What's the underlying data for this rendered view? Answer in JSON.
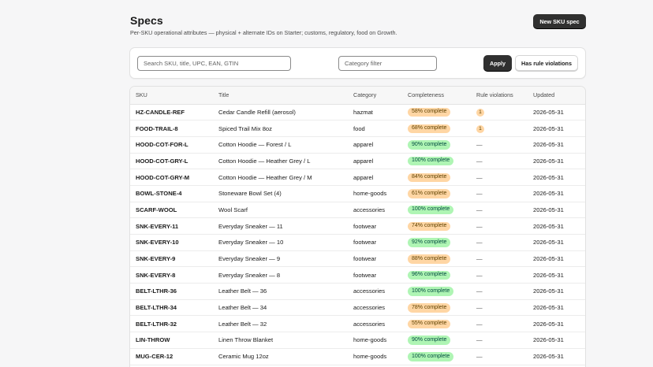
{
  "header": {
    "title": "Specs",
    "subtitle": "Per-SKU operational attributes — physical + alternate IDs on Starter; customs, regulatory, food on Growth.",
    "new_button": "New SKU spec"
  },
  "filters": {
    "search_placeholder": "Search SKU, title, UPC, EAN, GTIN",
    "category_placeholder": "Category filter",
    "apply_label": "Apply",
    "violations_label": "Has rule violations"
  },
  "table": {
    "columns": [
      "SKU",
      "Title",
      "Category",
      "Completeness",
      "Rule violations",
      "Updated"
    ],
    "rows": [
      {
        "sku": "HZ-CANDLE-REF",
        "title": "Cedar Candle Refill (aerosol)",
        "category": "hazmat",
        "completeness": "58% complete",
        "status": "orange",
        "violations": "1",
        "updated": "2026-05-31"
      },
      {
        "sku": "FOOD-TRAIL-8",
        "title": "Spiced Trail Mix 8oz",
        "category": "food",
        "completeness": "68% complete",
        "status": "orange",
        "violations": "1",
        "updated": "2026-05-31"
      },
      {
        "sku": "HOOD-COT-FOR-L",
        "title": "Cotton Hoodie — Forest / L",
        "category": "apparel",
        "completeness": "90% complete",
        "status": "green",
        "violations": "—",
        "updated": "2026-05-31"
      },
      {
        "sku": "HOOD-COT-GRY-L",
        "title": "Cotton Hoodie — Heather Grey / L",
        "category": "apparel",
        "completeness": "100% complete",
        "status": "green",
        "violations": "—",
        "updated": "2026-05-31"
      },
      {
        "sku": "HOOD-COT-GRY-M",
        "title": "Cotton Hoodie — Heather Grey / M",
        "category": "apparel",
        "completeness": "84% complete",
        "status": "orange",
        "violations": "—",
        "updated": "2026-05-31"
      },
      {
        "sku": "BOWL-STONE-4",
        "title": "Stoneware Bowl Set (4)",
        "category": "home-goods",
        "completeness": "61% complete",
        "status": "orange",
        "violations": "—",
        "updated": "2026-05-31"
      },
      {
        "sku": "SCARF-WOOL",
        "title": "Wool Scarf",
        "category": "accessories",
        "completeness": "100% complete",
        "status": "green",
        "violations": "—",
        "updated": "2026-05-31"
      },
      {
        "sku": "SNK-EVERY-11",
        "title": "Everyday Sneaker — 11",
        "category": "footwear",
        "completeness": "74% complete",
        "status": "orange",
        "violations": "—",
        "updated": "2026-05-31"
      },
      {
        "sku": "SNK-EVERY-10",
        "title": "Everyday Sneaker — 10",
        "category": "footwear",
        "completeness": "92% complete",
        "status": "green",
        "violations": "—",
        "updated": "2026-05-31"
      },
      {
        "sku": "SNK-EVERY-9",
        "title": "Everyday Sneaker — 9",
        "category": "footwear",
        "completeness": "88% complete",
        "status": "orange",
        "violations": "—",
        "updated": "2026-05-31"
      },
      {
        "sku": "SNK-EVERY-8",
        "title": "Everyday Sneaker — 8",
        "category": "footwear",
        "completeness": "96% complete",
        "status": "green",
        "violations": "—",
        "updated": "2026-05-31"
      },
      {
        "sku": "BELT-LTHR-36",
        "title": "Leather Belt — 36",
        "category": "accessories",
        "completeness": "100% complete",
        "status": "green",
        "violations": "—",
        "updated": "2026-05-31"
      },
      {
        "sku": "BELT-LTHR-34",
        "title": "Leather Belt — 34",
        "category": "accessories",
        "completeness": "78% complete",
        "status": "orange",
        "violations": "—",
        "updated": "2026-05-31"
      },
      {
        "sku": "BELT-LTHR-32",
        "title": "Leather Belt — 32",
        "category": "accessories",
        "completeness": "55% complete",
        "status": "orange",
        "violations": "—",
        "updated": "2026-05-31"
      },
      {
        "sku": "LIN-THROW",
        "title": "Linen Throw Blanket",
        "category": "home-goods",
        "completeness": "90% complete",
        "status": "green",
        "violations": "—",
        "updated": "2026-05-31"
      },
      {
        "sku": "MUG-CER-12",
        "title": "Ceramic Mug 12oz",
        "category": "home-goods",
        "completeness": "100% complete",
        "status": "green",
        "violations": "—",
        "updated": "2026-05-31"
      }
    ]
  },
  "colors": {
    "status_orange": "#ffd6a4",
    "status_green": "#aff5b4",
    "primary_button": "#303030"
  }
}
